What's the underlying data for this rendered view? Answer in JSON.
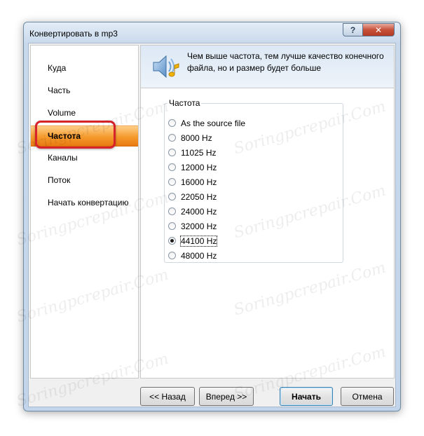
{
  "window": {
    "title": "Конвертировать в mp3",
    "help_label": "?",
    "close_label": "✕"
  },
  "sidebar": {
    "items": [
      {
        "label": "Куда"
      },
      {
        "label": "Часть"
      },
      {
        "label": "Volume"
      },
      {
        "label": "Частота"
      },
      {
        "label": "Каналы"
      },
      {
        "label": "Поток"
      },
      {
        "label": "Начать конвертацию"
      }
    ],
    "selected_index": 3
  },
  "header": {
    "icon": "speaker-music-icon",
    "text": "Чем выше частота, тем лучше качество конечного файла, но и размер будет больше"
  },
  "frequency": {
    "group_label": "Частота",
    "options": [
      "As the source file",
      "8000 Hz",
      "11025 Hz",
      "12000 Hz",
      "16000 Hz",
      "22050 Hz",
      "24000 Hz",
      "32000 Hz",
      "44100 Hz",
      "48000 Hz"
    ],
    "selected": "44100 Hz"
  },
  "buttons": {
    "back": "<< Назад",
    "next": "Вперед >>",
    "start": "Начать",
    "cancel": "Отмена"
  },
  "watermark": "Soringpcrepair.Com",
  "colors": {
    "selected_item": "#f59a2c",
    "annotation_border": "#d8232a",
    "title_gradient": "#c8d9ec"
  }
}
